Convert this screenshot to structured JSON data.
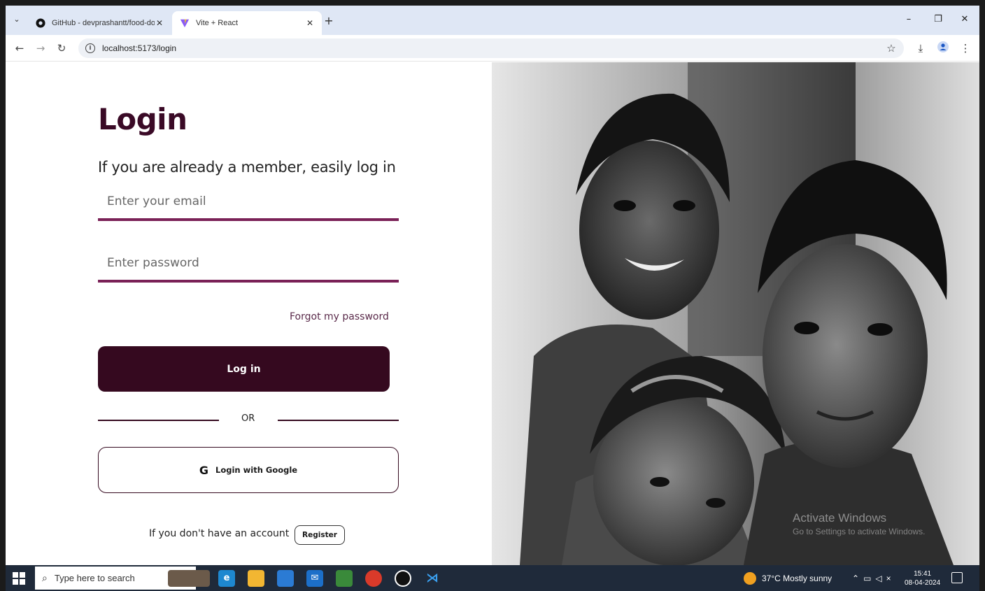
{
  "browser": {
    "tabs": [
      {
        "title": "GitHub - devprashantt/food-do",
        "active": false
      },
      {
        "title": "Vite + React",
        "active": true
      }
    ],
    "url": "localhost:5173/login"
  },
  "login": {
    "heading": "Login",
    "subtitle": "If you are already a member, easily log in",
    "email_placeholder": "Enter your email",
    "password_placeholder": "Enter password",
    "forgot": "Forgot my password",
    "login_button": "Log in",
    "or": "OR",
    "google_button": "Login with Google",
    "google_glyph": "G",
    "no_account": "If you don't have an account",
    "register_button": "Register"
  },
  "watermark": {
    "line1": "Activate Windows",
    "line2": "Go to Settings to activate Windows."
  },
  "taskbar": {
    "search_placeholder": "Type here to search",
    "weather": "37°C  Mostly sunny",
    "time": "15:41",
    "date": "08-04-2024"
  },
  "colors": {
    "brand": "#35091f",
    "accent": "#7a2157"
  }
}
